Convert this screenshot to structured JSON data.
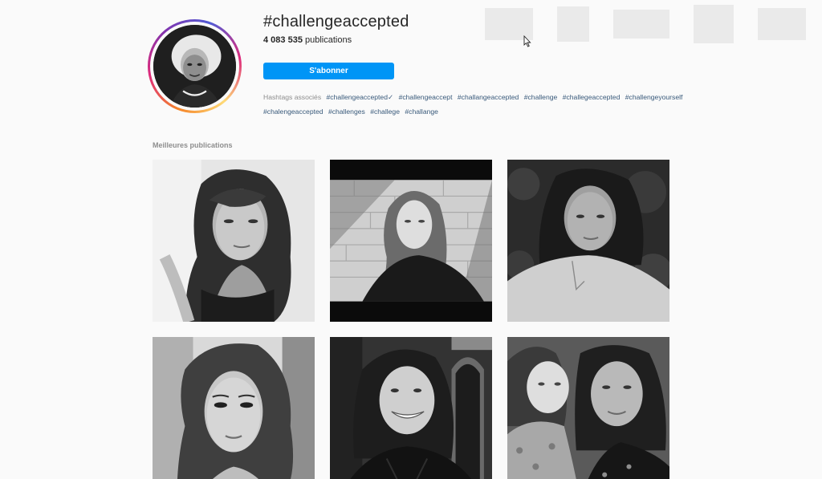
{
  "header": {
    "hashtag": "#challengeaccepted",
    "post_count": "4 083 535",
    "post_count_suffix": " publications",
    "follow_label": "S'abonner"
  },
  "related": {
    "label": "Hashtags associés",
    "tags": [
      "#challengeaccepted✓",
      "#challengeaccept",
      "#challangeaccepted",
      "#challenge",
      "#challegeaccepted",
      "#challengeyourself",
      "#chalengeaccepted",
      "#challenges",
      "#challege",
      "#challange"
    ]
  },
  "top_posts": {
    "label": "Meilleures publications"
  },
  "icons": {
    "cursor": "arrow-cursor-icon"
  },
  "colors": {
    "accent": "#0095f6",
    "tag_link": "#38597a",
    "muted": "#8e8e8e"
  }
}
